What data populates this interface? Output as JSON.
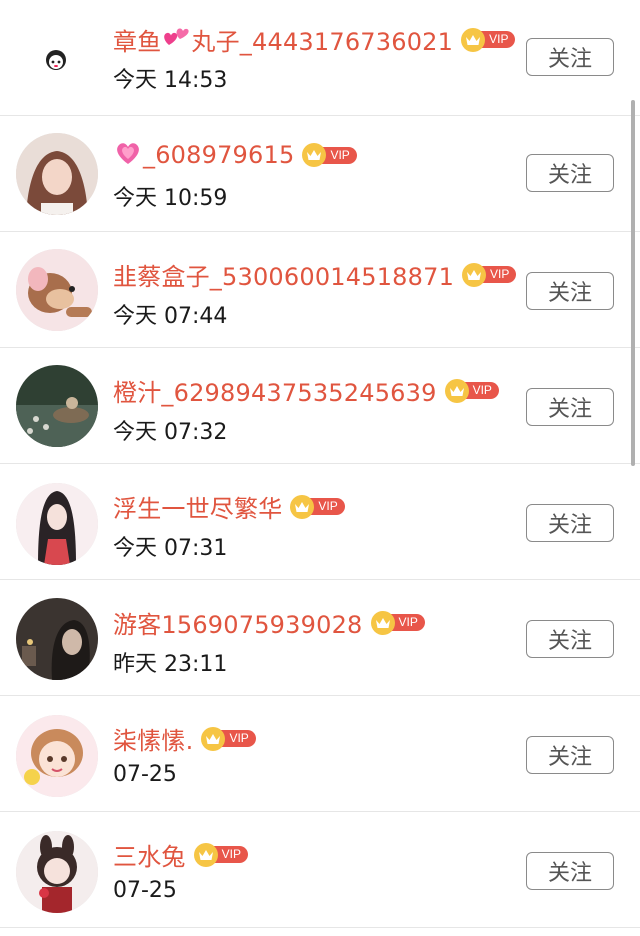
{
  "follow_label": "关注",
  "vip_label": "VIP",
  "rows": [
    {
      "name_prefix": "章鱼",
      "name_suffix": "丸子_4443176736021",
      "time": "今天 14:53"
    },
    {
      "name_suffix": "_608979615",
      "time": "今天 10:59"
    },
    {
      "name": "韭蔡盒子_530060014518871",
      "time": "今天 07:44"
    },
    {
      "name": "橙汁_62989437535245639",
      "time": "今天 07:32"
    },
    {
      "name": "浮生一世尽繁华",
      "time": "今天 07:31"
    },
    {
      "name": "游客1569075939028",
      "time": "昨天 23:11"
    },
    {
      "name": "柒愫愫.",
      "time": "07-25"
    },
    {
      "name": "三水兔",
      "time": "07-25"
    }
  ],
  "colors": {
    "name": "#e0553f",
    "vip_tag": "#e8564a",
    "crown": "#f6c544",
    "divider": "#e6e6e6"
  },
  "icons": [
    "two-hearts-icon",
    "sparkling-heart-icon",
    "crown-icon"
  ]
}
